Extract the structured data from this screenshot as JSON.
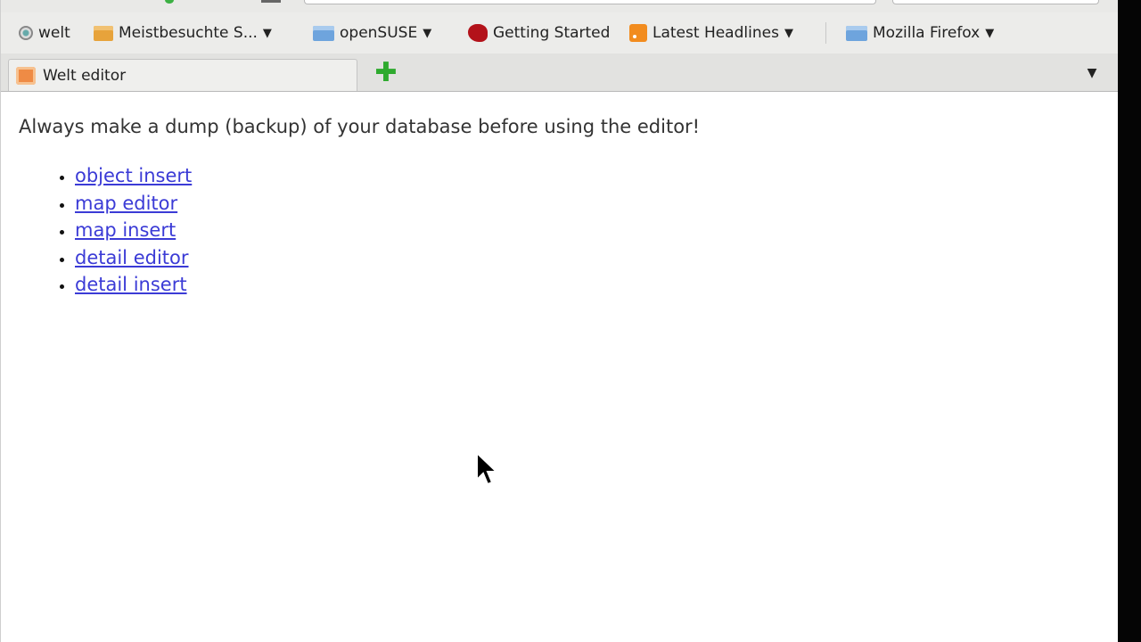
{
  "bookmarks": [
    {
      "label": "welt",
      "icon": "globe-icon",
      "has_menu": false
    },
    {
      "label": "Meistbesuchte S...",
      "icon": "folder-icon",
      "has_menu": true
    },
    {
      "label": "openSUSE",
      "icon": "folder-icon",
      "has_menu": true
    },
    {
      "label": "Getting Started",
      "icon": "gecko-icon",
      "has_menu": false
    },
    {
      "label": "Latest Headlines",
      "icon": "rss-icon",
      "has_menu": true
    },
    {
      "label": "Mozilla Firefox",
      "icon": "folder-icon",
      "has_menu": true
    }
  ],
  "tabs": [
    {
      "label": "Welt editor",
      "active": true
    }
  ],
  "new_tab_symbol": "✚",
  "tab_list_symbol": "▼",
  "chevron": "▼",
  "page": {
    "warning": "Always make a dump (backup) of your database before using the editor!",
    "links": [
      {
        "label": "object insert"
      },
      {
        "label": "map editor"
      },
      {
        "label": "map insert"
      },
      {
        "label": "detail editor"
      },
      {
        "label": "detail insert"
      }
    ]
  },
  "colors": {
    "link": "#3b3bd6",
    "new_tab": "#2eaa2e",
    "chrome": "#ececea"
  }
}
